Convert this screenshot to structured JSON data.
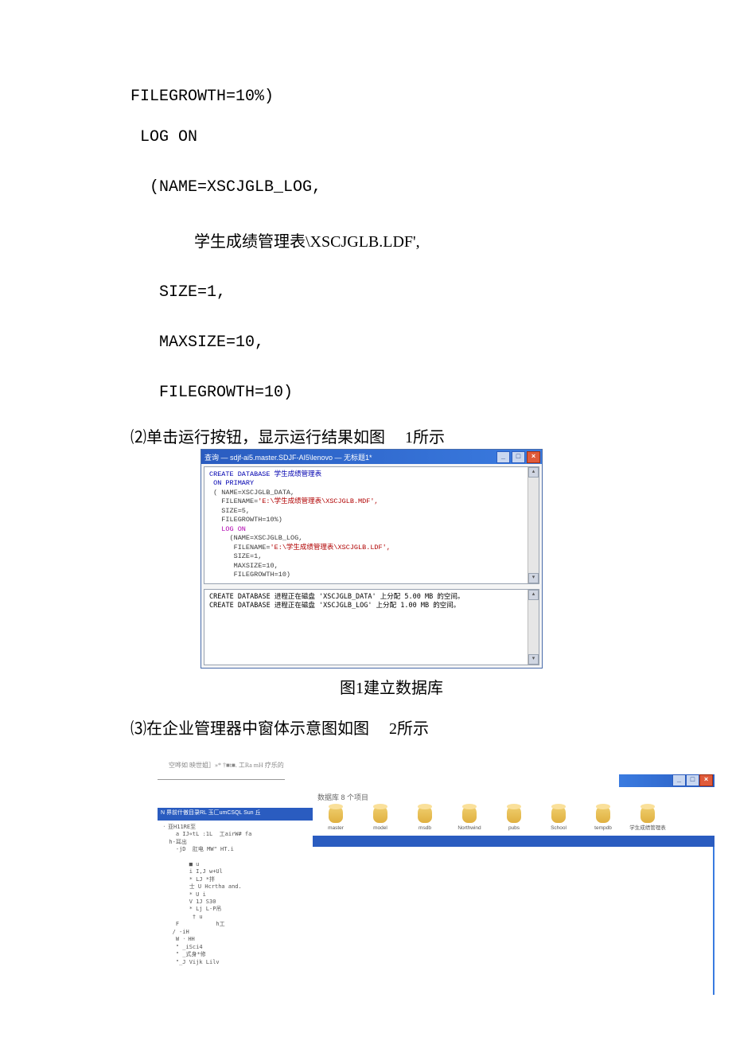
{
  "code": {
    "l0": "FILEGROWTH=10%)",
    "l1": " LOG ON",
    "l2": "  (NAME=XSCJGLB_LOG,",
    "l3": "                学生成绩管理表\\XSCJGLB.LDF',",
    "l4": "   SIZE=1,",
    "l5": "   MAXSIZE=10,",
    "l6": "   FILEGROWTH=10)"
  },
  "step2": "⑵单击运行按钮，显示运行结果如图     1所示",
  "fig1": {
    "title": "查询 — sdjf-ai5.master.SDJF-AI5\\lenovo — 无标题1*",
    "pane_top": {
      "l0": {
        "cls": "da",
        "t": "CREATE DATABASE 学生成绩管理表"
      },
      "l1": {
        "cls": "da",
        "t": " ON PRIMARY"
      },
      "l2": {
        "cls": "dg",
        "t": " ( NAME=XSCJGLB_DATA,"
      },
      "l3_a": {
        "cls": "dg",
        "t": "   FILENAME="
      },
      "l3_b": {
        "cls": "dr",
        "t": "'E:\\学生成绩管理表\\XSCJGLB.MDF',"
      },
      "l4": {
        "cls": "dg",
        "t": "   SIZE=5,"
      },
      "l5": {
        "cls": "dg",
        "t": "   FILEGROWTH=10%)"
      },
      "l6": {
        "cls": "dm",
        "t": "   LOG ON"
      },
      "l7": {
        "cls": "dg",
        "t": "     (NAME=XSCJGLB_LOG,"
      },
      "l8_a": {
        "cls": "dg",
        "t": "      FILENAME="
      },
      "l8_b": {
        "cls": "dr",
        "t": "'E:\\学生成绩管理表\\XSCJGLB.LDF',"
      },
      "l9": {
        "cls": "dg",
        "t": "      SIZE=1,"
      },
      "l10": {
        "cls": "dg",
        "t": "      MAXSIZE=10,"
      },
      "l11": {
        "cls": "dg",
        "t": "      FILEGROWTH=10)"
      }
    },
    "pane_bottom": {
      "m0": "CREATE DATABASE 进程正在磁盘 'XSCJGLB_DATA' 上分配 5.00 MB 的空间。",
      "m1": "CREATE DATABASE 进程正在磁盘 'XSCJGLB_LOG' 上分配 1.00 MB 的空间。"
    },
    "caption": "图1建立数据库"
  },
  "step3": "⑶在企业管理器中窗体示意图如图     2所示",
  "fig2": {
    "menu_hint": "空哗如 映世姐］»* †■t■. 工Ra mH  疗乐的",
    "header": "数据库     8 个项目",
    "dbs": [
      "master",
      "model",
      "msdb",
      "Northwind",
      "pubs",
      "School",
      "tempdb",
      "学生成绩管理表"
    ],
    "left_strip": "N 界前什傲目录RL 玉匚umCSQL Sun 丘",
    "tree": "᠂ 亚H11RE至\n    a IJ«tL :1L  工airW# fa\n  h-耳出\n    -jD  肛电 MW\" HT.i\n\n        ■ u\n        i I,J w+Ul\n        * LJ *拌\n        士 U Hcrtha and.\n        * U i\n        V 1J S30\n        * Lj L-P吊\n         † u\n    F           h工\n   / -iH\n    W ᠂ HH\n    \" _iSci4\n    \" _式身*修\n    \"_J Vijk Lilv"
  }
}
